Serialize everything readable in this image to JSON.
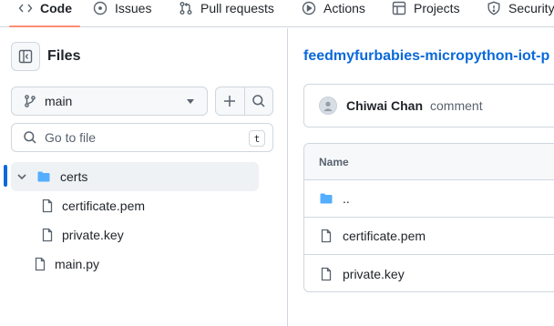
{
  "nav": {
    "tabs": [
      {
        "label": "Code",
        "icon": "code-icon",
        "active": true
      },
      {
        "label": "Issues",
        "icon": "issue-opened-icon"
      },
      {
        "label": "Pull requests",
        "icon": "git-pull-request-icon"
      },
      {
        "label": "Actions",
        "icon": "play-icon"
      },
      {
        "label": "Projects",
        "icon": "table-icon"
      },
      {
        "label": "Security",
        "icon": "shield-icon"
      }
    ]
  },
  "sidebar": {
    "title": "Files",
    "branch": "main",
    "goto_placeholder": "Go to file",
    "goto_shortcut": "t",
    "tree": [
      {
        "label": "certs",
        "type": "folder",
        "expanded": true
      },
      {
        "label": "certificate.pem",
        "type": "file"
      },
      {
        "label": "private.key",
        "type": "file"
      },
      {
        "label": "main.py",
        "type": "file"
      }
    ]
  },
  "main": {
    "repo_path": "feedmyfurbabies-micropython-iot-p",
    "commit": {
      "author": "Chiwai Chan",
      "message": "comment"
    },
    "table": {
      "header": "Name",
      "rows": [
        {
          "label": "..",
          "type": "folder"
        },
        {
          "label": "certificate.pem",
          "type": "file"
        },
        {
          "label": "private.key",
          "type": "file"
        }
      ]
    }
  },
  "colors": {
    "accent": "#0969da",
    "folder": "#54aeff",
    "tab_underline": "#fd8c73",
    "border": "#d0d7de"
  }
}
